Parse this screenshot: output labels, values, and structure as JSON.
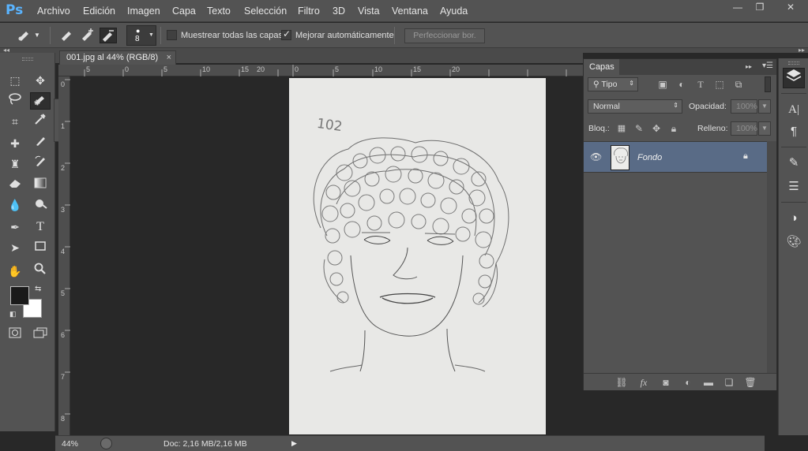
{
  "app": {
    "logo": "Ps"
  },
  "menu": [
    "Archivo",
    "Edición",
    "Imagen",
    "Capa",
    "Texto",
    "Selección",
    "Filtro",
    "3D",
    "Vista",
    "Ventana",
    "Ayuda"
  ],
  "window_controls": {
    "minimize": "—",
    "restore": "❐",
    "close": "✕"
  },
  "options_bar": {
    "brush_size": "8",
    "sample_all_layers_label": "Muestrear todas las capas",
    "sample_all_layers_checked": false,
    "auto_enhance_label": "Mejorar automáticamente",
    "auto_enhance_checked": true,
    "refine_edge_label": "Perfeccionar bor."
  },
  "document": {
    "tab_title": "001.jpg al 44% (RGB/8)",
    "tab_close": "×",
    "sketch_note": "102"
  },
  "rulers": {
    "horizontal": [
      "5",
      "0",
      "5",
      "10",
      "15",
      "20",
      "25",
      "0",
      "5",
      "10",
      "15",
      "20"
    ],
    "vertical": [
      "0",
      "1",
      "2",
      "3",
      "4",
      "5",
      "6",
      "7",
      "8"
    ]
  },
  "status_bar": {
    "zoom": "44%",
    "doc_info": "Doc: 2,16 MB/2,16 MB"
  },
  "layers_panel": {
    "tab_label": "Capas",
    "filter_type": "Tipo",
    "blend_mode": "Normal",
    "opacity_label": "Opacidad:",
    "opacity_value": "100%",
    "lock_label": "Bloq.:",
    "fill_label": "Relleno:",
    "fill_value": "100%",
    "layers": [
      {
        "name": "Fondo",
        "visible": true,
        "locked": true
      }
    ]
  },
  "colors": {
    "ui_panel": "#535353",
    "ui_dark": "#282828",
    "selected_layer": "#596b86",
    "ps_blue": "#5ab4ff",
    "foreground": "#1a1a1a",
    "background": "#ffffff"
  },
  "icons": {
    "tools": [
      "marquee-icon",
      "move-icon",
      "lasso-icon",
      "quick-selection-icon",
      "crop-icon",
      "eyedropper-icon",
      "healing-brush-icon",
      "brush-icon",
      "clone-stamp-icon",
      "history-brush-icon",
      "eraser-icon",
      "gradient-icon",
      "blur-icon",
      "dodge-icon",
      "pen-icon",
      "type-icon",
      "path-selection-icon",
      "rectangle-icon",
      "hand-icon",
      "zoom-icon"
    ],
    "dock": [
      "layers-icon",
      "character-icon",
      "paragraph-icon",
      "brush-presets-icon",
      "adjustments-icon",
      "styles-icon",
      "swatches-icon"
    ],
    "layer_footer": [
      "link-icon",
      "fx-icon",
      "mask-icon",
      "adjustment-layer-icon",
      "group-icon",
      "new-layer-icon",
      "trash-icon"
    ]
  }
}
